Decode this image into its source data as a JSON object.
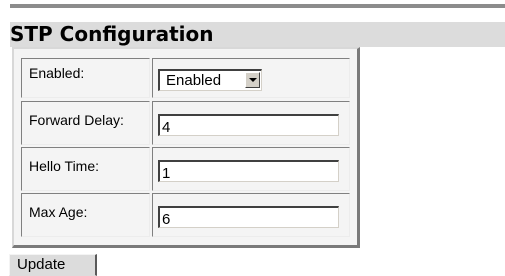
{
  "page": {
    "title": "STP Configuration"
  },
  "form": {
    "enabled": {
      "label": "Enabled:",
      "selected": "Enabled"
    },
    "forward_delay": {
      "label": "Forward Delay:",
      "value": "4"
    },
    "hello_time": {
      "label": "Hello Time:",
      "value": "1"
    },
    "max_age": {
      "label": "Max Age:",
      "value": "6"
    }
  },
  "actions": {
    "update_label": "Update"
  },
  "icons": {
    "select_arrow": "chevron-down-icon"
  },
  "colors": {
    "title_bar_bg": "#dcdcdc",
    "top_rule": "#8c8c8c",
    "panel_bg": "#f4f4f4",
    "button_bg": "#dcdcdc"
  }
}
